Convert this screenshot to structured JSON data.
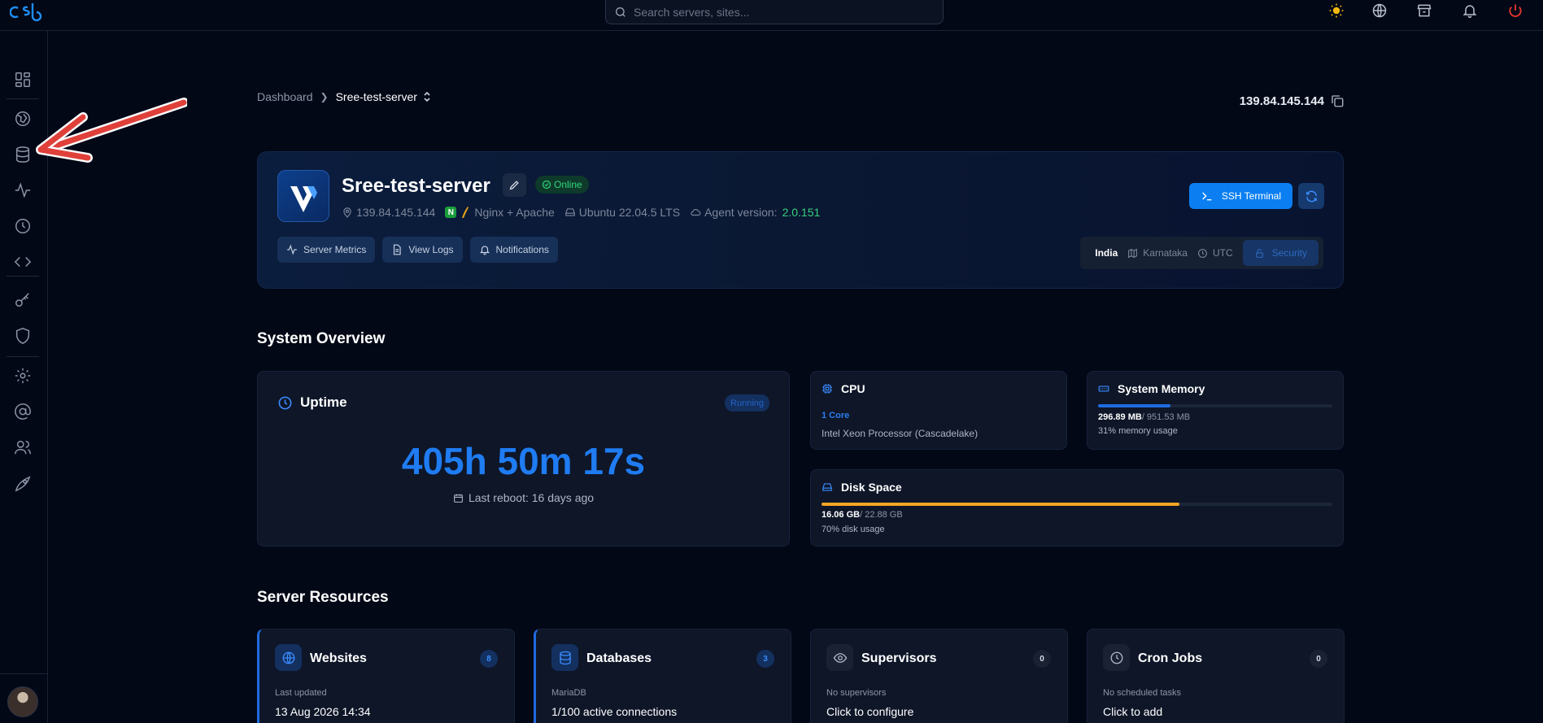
{
  "search": {
    "placeholder": "Search servers, sites..."
  },
  "breadcrumb": {
    "home": "Dashboard",
    "current": "Sree-test-server"
  },
  "server": {
    "ip_top": "139.84.145.144",
    "name": "Sree-test-server",
    "status": "Online",
    "ip": "139.84.145.144",
    "webserver": "Nginx + Apache",
    "os": "Ubuntu 22.04.5 LTS",
    "agent_label": "Agent version:",
    "agent_version": "2.0.151",
    "buttons": {
      "metrics": "Server Metrics",
      "logs": "View Logs",
      "notifications": "Notifications"
    },
    "ssh_label": "SSH Terminal",
    "location": {
      "country": "India",
      "region": "Karnataka",
      "timezone": "UTC",
      "security": "Security"
    }
  },
  "overview": {
    "title": "System Overview",
    "uptime": {
      "title": "Uptime",
      "badge": "Running",
      "value": "405h 50m 17s",
      "reboot": "Last reboot: 16 days ago"
    },
    "cpu": {
      "title": "CPU",
      "cores": "1 Core",
      "model": "Intel Xeon Processor (Cascadelake)"
    },
    "memory": {
      "title": "System Memory",
      "used": "296.89 MB",
      "total": "/ 951.53 MB",
      "usage": "31% memory usage",
      "fraction": 0.31,
      "color": "#1f6be0"
    },
    "disk": {
      "title": "Disk Space",
      "used": "16.06 GB",
      "total": "/ 22.88 GB",
      "usage": "70% disk usage",
      "fraction": 0.7,
      "color": "#f5a524"
    }
  },
  "resources": {
    "title": "Server Resources",
    "websites": {
      "title": "Websites",
      "count": "8",
      "sub": "Last updated",
      "main": "13 Aug 2026 14:34"
    },
    "databases": {
      "title": "Databases",
      "count": "3",
      "sub": "MariaDB",
      "main": "1/100 active connections"
    },
    "supervisors": {
      "title": "Supervisors",
      "count": "0",
      "sub": "No supervisors",
      "main": "Click to configure"
    },
    "cron": {
      "title": "Cron Jobs",
      "count": "0",
      "sub": "No scheduled tasks",
      "main": "Click to add"
    }
  },
  "colors": {
    "accent": "#1f7cf2",
    "online": "#32d67b",
    "background": "#030817",
    "card": "#0e1628",
    "annotation_arrow": "#e0403a"
  },
  "icons": [
    "theme-sun-icon",
    "globe-icon",
    "store-icon",
    "bell-icon",
    "power-icon"
  ]
}
